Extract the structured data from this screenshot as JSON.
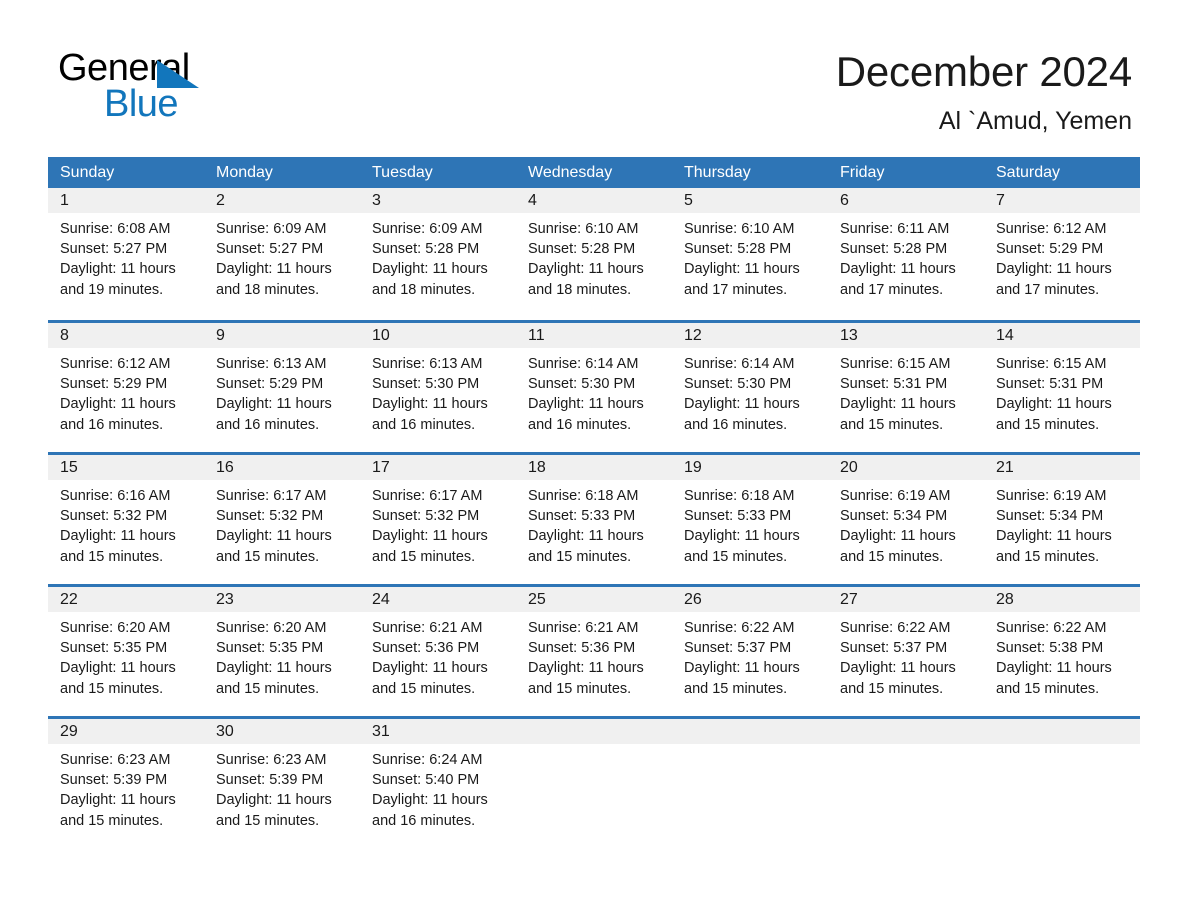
{
  "logo": {
    "word_top": "General",
    "word_bottom": "Blue",
    "triangle_icon": "triangle-icon",
    "brand_color": "#1276bc"
  },
  "header": {
    "title": "December 2024",
    "subtitle": "Al `Amud, Yemen"
  },
  "theme": {
    "header_blue": "#2e75b6",
    "daynum_band": "#f0f0f0",
    "text": "#1a1a1a"
  },
  "weekdays": [
    "Sunday",
    "Monday",
    "Tuesday",
    "Wednesday",
    "Thursday",
    "Friday",
    "Saturday"
  ],
  "weeks": [
    [
      {
        "day": "1",
        "sunrise": "Sunrise: 6:08 AM",
        "sunset": "Sunset: 5:27 PM",
        "daylight_1": "Daylight: 11 hours",
        "daylight_2": "and 19 minutes."
      },
      {
        "day": "2",
        "sunrise": "Sunrise: 6:09 AM",
        "sunset": "Sunset: 5:27 PM",
        "daylight_1": "Daylight: 11 hours",
        "daylight_2": "and 18 minutes."
      },
      {
        "day": "3",
        "sunrise": "Sunrise: 6:09 AM",
        "sunset": "Sunset: 5:28 PM",
        "daylight_1": "Daylight: 11 hours",
        "daylight_2": "and 18 minutes."
      },
      {
        "day": "4",
        "sunrise": "Sunrise: 6:10 AM",
        "sunset": "Sunset: 5:28 PM",
        "daylight_1": "Daylight: 11 hours",
        "daylight_2": "and 18 minutes."
      },
      {
        "day": "5",
        "sunrise": "Sunrise: 6:10 AM",
        "sunset": "Sunset: 5:28 PM",
        "daylight_1": "Daylight: 11 hours",
        "daylight_2": "and 17 minutes."
      },
      {
        "day": "6",
        "sunrise": "Sunrise: 6:11 AM",
        "sunset": "Sunset: 5:28 PM",
        "daylight_1": "Daylight: 11 hours",
        "daylight_2": "and 17 minutes."
      },
      {
        "day": "7",
        "sunrise": "Sunrise: 6:12 AM",
        "sunset": "Sunset: 5:29 PM",
        "daylight_1": "Daylight: 11 hours",
        "daylight_2": "and 17 minutes."
      }
    ],
    [
      {
        "day": "8",
        "sunrise": "Sunrise: 6:12 AM",
        "sunset": "Sunset: 5:29 PM",
        "daylight_1": "Daylight: 11 hours",
        "daylight_2": "and 16 minutes."
      },
      {
        "day": "9",
        "sunrise": "Sunrise: 6:13 AM",
        "sunset": "Sunset: 5:29 PM",
        "daylight_1": "Daylight: 11 hours",
        "daylight_2": "and 16 minutes."
      },
      {
        "day": "10",
        "sunrise": "Sunrise: 6:13 AM",
        "sunset": "Sunset: 5:30 PM",
        "daylight_1": "Daylight: 11 hours",
        "daylight_2": "and 16 minutes."
      },
      {
        "day": "11",
        "sunrise": "Sunrise: 6:14 AM",
        "sunset": "Sunset: 5:30 PM",
        "daylight_1": "Daylight: 11 hours",
        "daylight_2": "and 16 minutes."
      },
      {
        "day": "12",
        "sunrise": "Sunrise: 6:14 AM",
        "sunset": "Sunset: 5:30 PM",
        "daylight_1": "Daylight: 11 hours",
        "daylight_2": "and 16 minutes."
      },
      {
        "day": "13",
        "sunrise": "Sunrise: 6:15 AM",
        "sunset": "Sunset: 5:31 PM",
        "daylight_1": "Daylight: 11 hours",
        "daylight_2": "and 15 minutes."
      },
      {
        "day": "14",
        "sunrise": "Sunrise: 6:15 AM",
        "sunset": "Sunset: 5:31 PM",
        "daylight_1": "Daylight: 11 hours",
        "daylight_2": "and 15 minutes."
      }
    ],
    [
      {
        "day": "15",
        "sunrise": "Sunrise: 6:16 AM",
        "sunset": "Sunset: 5:32 PM",
        "daylight_1": "Daylight: 11 hours",
        "daylight_2": "and 15 minutes."
      },
      {
        "day": "16",
        "sunrise": "Sunrise: 6:17 AM",
        "sunset": "Sunset: 5:32 PM",
        "daylight_1": "Daylight: 11 hours",
        "daylight_2": "and 15 minutes."
      },
      {
        "day": "17",
        "sunrise": "Sunrise: 6:17 AM",
        "sunset": "Sunset: 5:32 PM",
        "daylight_1": "Daylight: 11 hours",
        "daylight_2": "and 15 minutes."
      },
      {
        "day": "18",
        "sunrise": "Sunrise: 6:18 AM",
        "sunset": "Sunset: 5:33 PM",
        "daylight_1": "Daylight: 11 hours",
        "daylight_2": "and 15 minutes."
      },
      {
        "day": "19",
        "sunrise": "Sunrise: 6:18 AM",
        "sunset": "Sunset: 5:33 PM",
        "daylight_1": "Daylight: 11 hours",
        "daylight_2": "and 15 minutes."
      },
      {
        "day": "20",
        "sunrise": "Sunrise: 6:19 AM",
        "sunset": "Sunset: 5:34 PM",
        "daylight_1": "Daylight: 11 hours",
        "daylight_2": "and 15 minutes."
      },
      {
        "day": "21",
        "sunrise": "Sunrise: 6:19 AM",
        "sunset": "Sunset: 5:34 PM",
        "daylight_1": "Daylight: 11 hours",
        "daylight_2": "and 15 minutes."
      }
    ],
    [
      {
        "day": "22",
        "sunrise": "Sunrise: 6:20 AM",
        "sunset": "Sunset: 5:35 PM",
        "daylight_1": "Daylight: 11 hours",
        "daylight_2": "and 15 minutes."
      },
      {
        "day": "23",
        "sunrise": "Sunrise: 6:20 AM",
        "sunset": "Sunset: 5:35 PM",
        "daylight_1": "Daylight: 11 hours",
        "daylight_2": "and 15 minutes."
      },
      {
        "day": "24",
        "sunrise": "Sunrise: 6:21 AM",
        "sunset": "Sunset: 5:36 PM",
        "daylight_1": "Daylight: 11 hours",
        "daylight_2": "and 15 minutes."
      },
      {
        "day": "25",
        "sunrise": "Sunrise: 6:21 AM",
        "sunset": "Sunset: 5:36 PM",
        "daylight_1": "Daylight: 11 hours",
        "daylight_2": "and 15 minutes."
      },
      {
        "day": "26",
        "sunrise": "Sunrise: 6:22 AM",
        "sunset": "Sunset: 5:37 PM",
        "daylight_1": "Daylight: 11 hours",
        "daylight_2": "and 15 minutes."
      },
      {
        "day": "27",
        "sunrise": "Sunrise: 6:22 AM",
        "sunset": "Sunset: 5:37 PM",
        "daylight_1": "Daylight: 11 hours",
        "daylight_2": "and 15 minutes."
      },
      {
        "day": "28",
        "sunrise": "Sunrise: 6:22 AM",
        "sunset": "Sunset: 5:38 PM",
        "daylight_1": "Daylight: 11 hours",
        "daylight_2": "and 15 minutes."
      }
    ],
    [
      {
        "day": "29",
        "sunrise": "Sunrise: 6:23 AM",
        "sunset": "Sunset: 5:39 PM",
        "daylight_1": "Daylight: 11 hours",
        "daylight_2": "and 15 minutes."
      },
      {
        "day": "30",
        "sunrise": "Sunrise: 6:23 AM",
        "sunset": "Sunset: 5:39 PM",
        "daylight_1": "Daylight: 11 hours",
        "daylight_2": "and 15 minutes."
      },
      {
        "day": "31",
        "sunrise": "Sunrise: 6:24 AM",
        "sunset": "Sunset: 5:40 PM",
        "daylight_1": "Daylight: 11 hours",
        "daylight_2": "and 16 minutes."
      },
      {
        "day": "",
        "sunrise": "",
        "sunset": "",
        "daylight_1": "",
        "daylight_2": ""
      },
      {
        "day": "",
        "sunrise": "",
        "sunset": "",
        "daylight_1": "",
        "daylight_2": ""
      },
      {
        "day": "",
        "sunrise": "",
        "sunset": "",
        "daylight_1": "",
        "daylight_2": ""
      },
      {
        "day": "",
        "sunrise": "",
        "sunset": "",
        "daylight_1": "",
        "daylight_2": ""
      }
    ]
  ]
}
